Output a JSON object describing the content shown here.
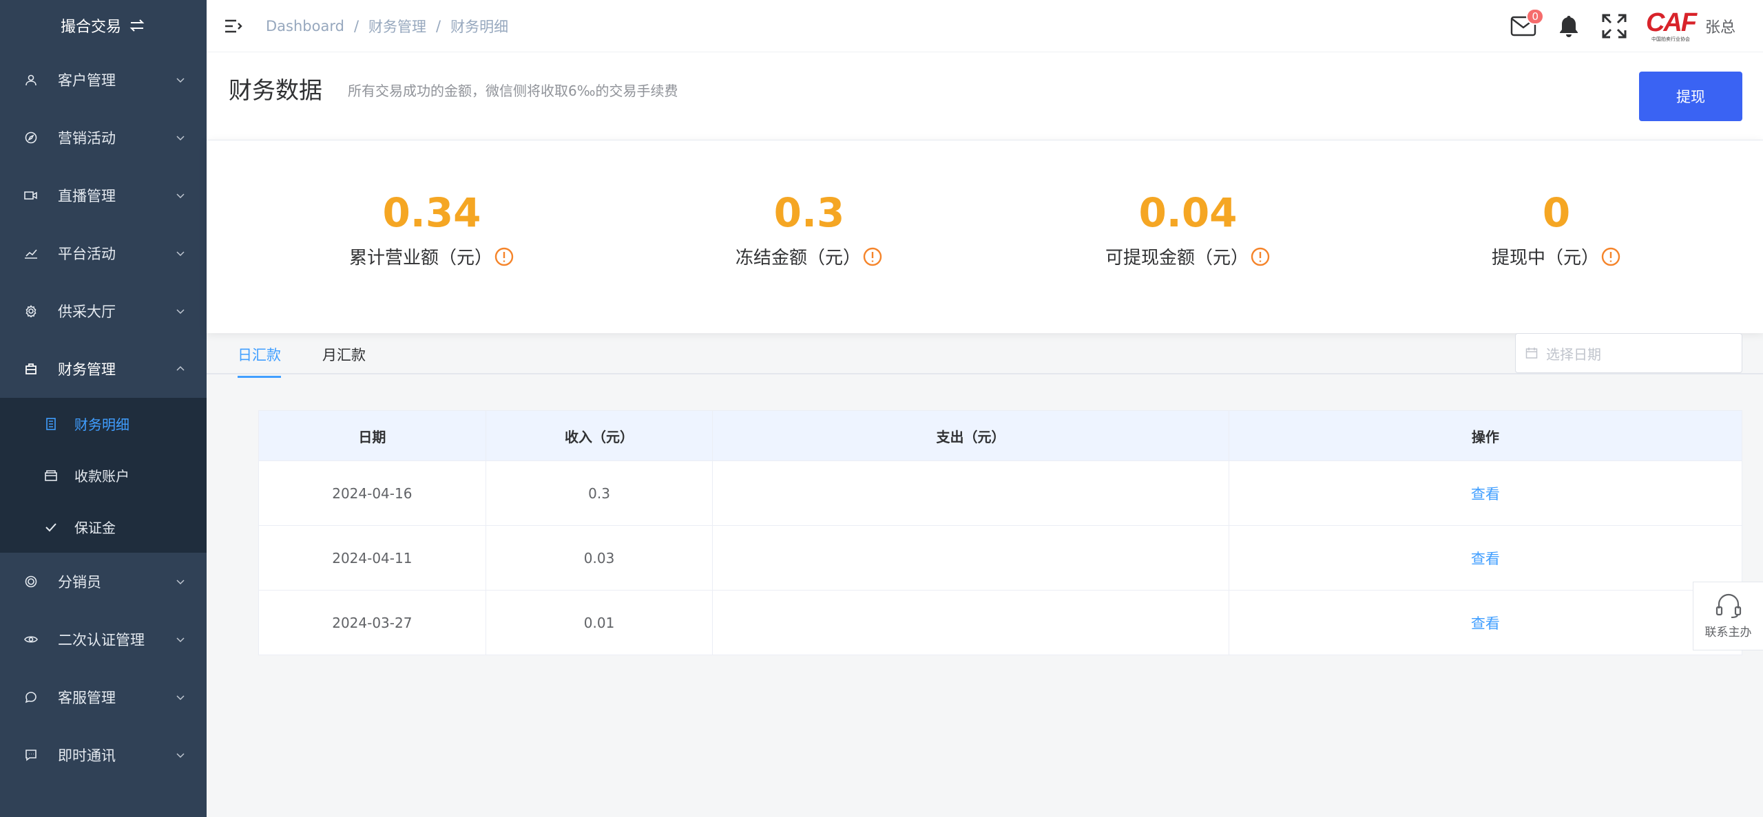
{
  "sidebar": {
    "header_title": "撮合交易",
    "items": [
      {
        "label": "客户管理",
        "icon": "user-icon"
      },
      {
        "label": "营销活动",
        "icon": "compass-icon"
      },
      {
        "label": "直播管理",
        "icon": "video-icon"
      },
      {
        "label": "平台活动",
        "icon": "chart-icon"
      },
      {
        "label": "供采大厅",
        "icon": "gear-icon"
      },
      {
        "label": "财务管理",
        "icon": "briefcase-icon"
      }
    ],
    "sub_items": [
      {
        "label": "财务明细",
        "icon": "document-icon"
      },
      {
        "label": "收款账户",
        "icon": "wallet-icon"
      },
      {
        "label": "保证金",
        "icon": "check-icon"
      }
    ],
    "items_after": [
      {
        "label": "分销员",
        "icon": "coin-icon"
      },
      {
        "label": "二次认证管理",
        "icon": "eye-icon"
      },
      {
        "label": "客服管理",
        "icon": "chat-icon"
      },
      {
        "label": "即时通讯",
        "icon": "message-icon"
      }
    ]
  },
  "topbar": {
    "breadcrumb": [
      "Dashboard",
      "财务管理",
      "财务明细"
    ],
    "mail_badge": "0",
    "logo_text": "CAF",
    "logo_sub": "中国拍卖行业协会",
    "username": "张总"
  },
  "page": {
    "title": "财务数据",
    "description": "所有交易成功的金额，微信侧将收取6‰的交易手续费",
    "withdraw_label": "提现"
  },
  "stats": [
    {
      "value": "0.34",
      "label": "累计营业额（元）"
    },
    {
      "value": "0.3",
      "label": "冻结金额（元）"
    },
    {
      "value": "0.04",
      "label": "可提现金额（元）"
    },
    {
      "value": "0",
      "label": "提现中（元）"
    }
  ],
  "tabs": {
    "daily": "日汇款",
    "monthly": "月汇款",
    "date_placeholder": "选择日期"
  },
  "table": {
    "headers": [
      "日期",
      "收入（元）",
      "支出（元）",
      "操作"
    ],
    "rows": [
      {
        "date": "2024-04-16",
        "income": "0.3",
        "expense": "",
        "action": "查看"
      },
      {
        "date": "2024-04-11",
        "income": "0.03",
        "expense": "",
        "action": "查看"
      },
      {
        "date": "2024-03-27",
        "income": "0.01",
        "expense": "",
        "action": "查看"
      }
    ]
  },
  "contact": {
    "label": "联系主办"
  },
  "colors": {
    "sidebar": "#304156",
    "accent": "#409eff",
    "stat": "#f5a623",
    "button": "#3a63f3"
  }
}
